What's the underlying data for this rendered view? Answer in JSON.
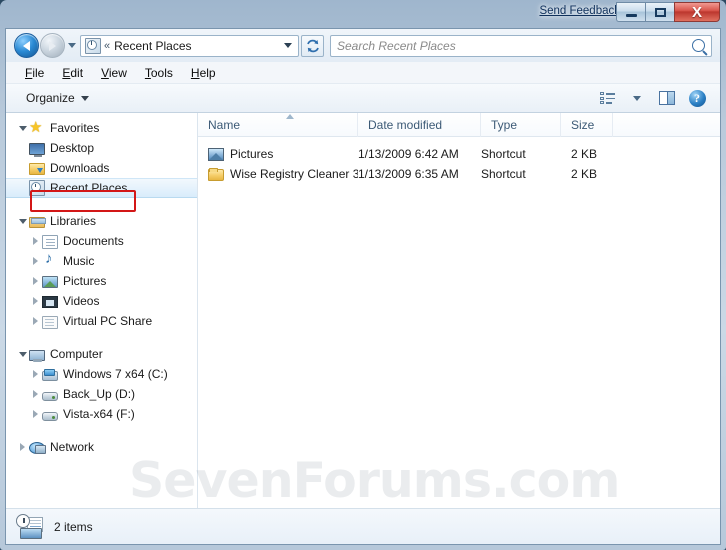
{
  "titlebar": {
    "send_feedback": "Send Feedback",
    "minimize_label": "Minimize",
    "maximize_label": "Maximize",
    "close_label": "X"
  },
  "navigation": {
    "back_label": "Back",
    "forward_label": "Forward",
    "history_label": "Recent pages",
    "breadcrumb_chevron": "«",
    "breadcrumb_text": "Recent Places",
    "breadcrumb_icon": "recent-places-icon",
    "refresh_label": "↻",
    "address_dropdown_label": "Previous locations"
  },
  "search": {
    "placeholder": "Search Recent Places",
    "value": "",
    "icon": "search-icon"
  },
  "menubar": {
    "items": [
      {
        "accel": "F",
        "rest": "ile"
      },
      {
        "accel": "E",
        "rest": "dit"
      },
      {
        "accel": "V",
        "rest": "iew"
      },
      {
        "accel": "T",
        "rest": "ools"
      },
      {
        "accel": "H",
        "rest": "elp"
      }
    ]
  },
  "commandbar": {
    "organize_label": "Organize",
    "views_label": "Change your view",
    "preview_pane_label": "Show the preview pane",
    "help_label": "?"
  },
  "sidebar": {
    "groups": [
      {
        "name": "Favorites",
        "icon": "star-icon",
        "expander": "open",
        "items": [
          {
            "label": "Desktop",
            "icon": "desktop-icon",
            "expander": "none",
            "selected": false
          },
          {
            "label": "Downloads",
            "icon": "downloads-folder-icon",
            "expander": "none",
            "selected": false
          },
          {
            "label": "Recent Places",
            "icon": "recent-places-icon",
            "expander": "none",
            "selected": true
          }
        ]
      },
      {
        "name": "Libraries",
        "icon": "libraries-icon",
        "expander": "open",
        "items": [
          {
            "label": "Documents",
            "icon": "documents-library-icon",
            "expander": "closed",
            "selected": false
          },
          {
            "label": "Music",
            "icon": "music-library-icon",
            "expander": "closed",
            "selected": false
          },
          {
            "label": "Pictures",
            "icon": "pictures-library-icon",
            "expander": "closed",
            "selected": false
          },
          {
            "label": "Videos",
            "icon": "videos-library-icon",
            "expander": "closed",
            "selected": false
          },
          {
            "label": "Virtual PC Share",
            "icon": "virtual-pc-share-icon",
            "expander": "closed",
            "selected": false
          }
        ]
      },
      {
        "name": "Computer",
        "icon": "computer-icon",
        "expander": "open",
        "items": [
          {
            "label": "Windows 7 x64 (C:)",
            "icon": "system-drive-icon",
            "expander": "closed",
            "selected": false
          },
          {
            "label": "Back_Up (D:)",
            "icon": "hard-drive-icon",
            "expander": "closed",
            "selected": false
          },
          {
            "label": "Vista-x64 (F:)",
            "icon": "hard-drive-icon",
            "expander": "closed",
            "selected": false
          }
        ]
      },
      {
        "name": "Network",
        "icon": "network-icon",
        "expander": "closed",
        "items": []
      }
    ]
  },
  "filelist": {
    "columns": [
      {
        "key": "name",
        "label": "Name",
        "sorted": "asc"
      },
      {
        "key": "date",
        "label": "Date modified",
        "sorted": ""
      },
      {
        "key": "type",
        "label": "Type",
        "sorted": ""
      },
      {
        "key": "size",
        "label": "Size",
        "sorted": ""
      }
    ],
    "rows": [
      {
        "name": "Pictures",
        "icon": "picture-shortcut-icon",
        "date": "1/13/2009 6:42 AM",
        "type": "Shortcut",
        "size": "2 KB"
      },
      {
        "name": "Wise Registry Cleaner 3",
        "icon": "folder-shortcut-icon",
        "date": "1/13/2009 6:35 AM",
        "type": "Shortcut",
        "size": "2 KB"
      }
    ]
  },
  "statusbar": {
    "icon": "recent-places-large-icon",
    "text": "2 items"
  },
  "watermark": {
    "text": "SevenForums.com"
  },
  "annotation": {
    "highlight_target": "Recent Places",
    "color": "#d31717"
  }
}
